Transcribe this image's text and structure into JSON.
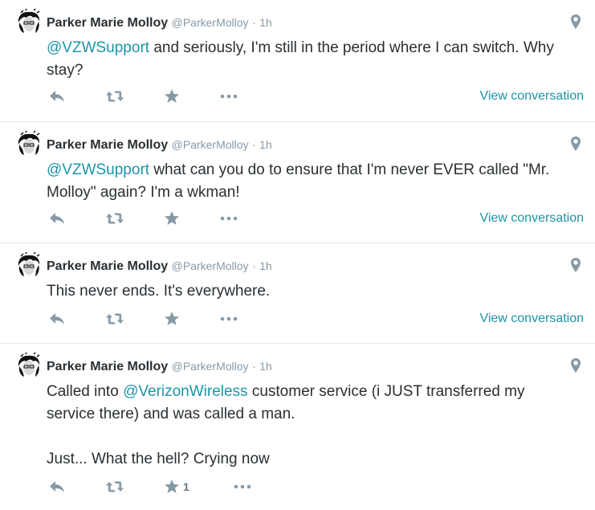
{
  "tweets": [
    {
      "name": "Parker Marie Molloy",
      "handle": "@ParkerMolloy",
      "dot": "·",
      "time": "1h",
      "mention": "@VZWSupport",
      "text_after_mention": " and seriously, I'm still in the period where I can switch. Why stay?",
      "view_conversation": "View conversation"
    },
    {
      "name": "Parker Marie Molloy",
      "handle": "@ParkerMolloy",
      "dot": "·",
      "time": "1h",
      "mention": "@VZWSupport",
      "text_after_mention": " what can you do to ensure that I'm never EVER called \"Mr. Molloy\" again? I'm a wkman!",
      "view_conversation": "View conversation"
    },
    {
      "name": "Parker Marie Molloy",
      "handle": "@ParkerMolloy",
      "dot": "·",
      "time": "1h",
      "text": "This never ends. It's everywhere.",
      "view_conversation": "View conversation"
    },
    {
      "name": "Parker Marie Molloy",
      "handle": "@ParkerMolloy",
      "dot": "·",
      "time": "1h",
      "text_before_mention": "Called into ",
      "mention": "@VerizonWireless",
      "text_after_mention": " customer service (i JUST transferred my service there) and was called a man.\n\nJust... What the hell? Crying now",
      "favorite_count": "1"
    }
  ],
  "icons": {
    "reply": "reply-icon",
    "retweet": "retweet-icon",
    "favorite": "star-icon",
    "more": "more-icon",
    "location": "location-pin-icon"
  },
  "colors": {
    "text": "#292f33",
    "muted": "#8899a6",
    "action_icon": "#8899a6",
    "link": "#1b95a8",
    "divider": "#e1e8ed"
  }
}
